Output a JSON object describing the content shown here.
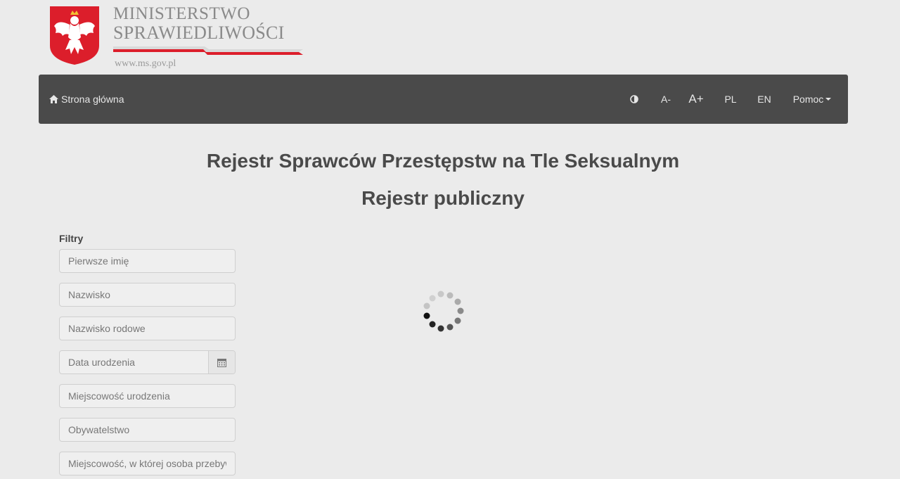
{
  "header": {
    "ministry_line1": "MINISTERSTWO",
    "ministry_line2": "SPRAWIEDLIWOŚCI",
    "url": "www.ms.gov.pl",
    "crest_icon": "polish-eagle-crest-icon",
    "colors": {
      "crest_red": "#dc1e2b",
      "stripe_red": "#dc1e2b"
    }
  },
  "navbar": {
    "home_label": "Strona główna",
    "home_icon": "home-icon",
    "contrast_icon": "contrast-icon",
    "font_decrease": "A-",
    "font_increase": "A+",
    "lang_pl": "PL",
    "lang_en": "EN",
    "help_label": "Pomoc",
    "background": "#4a4a4a"
  },
  "page": {
    "title": "Rejestr Sprawców Przestępstw na Tle Seksualnym",
    "subtitle": "Rejestr publiczny"
  },
  "filters": {
    "label": "Filtry",
    "fields": {
      "first_name": "Pierwsze imię",
      "last_name": "Nazwisko",
      "family_name": "Nazwisko rodowe",
      "birth_date": "Data urodzenia",
      "birth_place": "Miejscowość urodzenia",
      "citizenship": "Obywatelstwo",
      "residence": "Miejscowość, w której osoba przebywa"
    }
  },
  "loading": {
    "icon": "loading-spinner-icon"
  }
}
